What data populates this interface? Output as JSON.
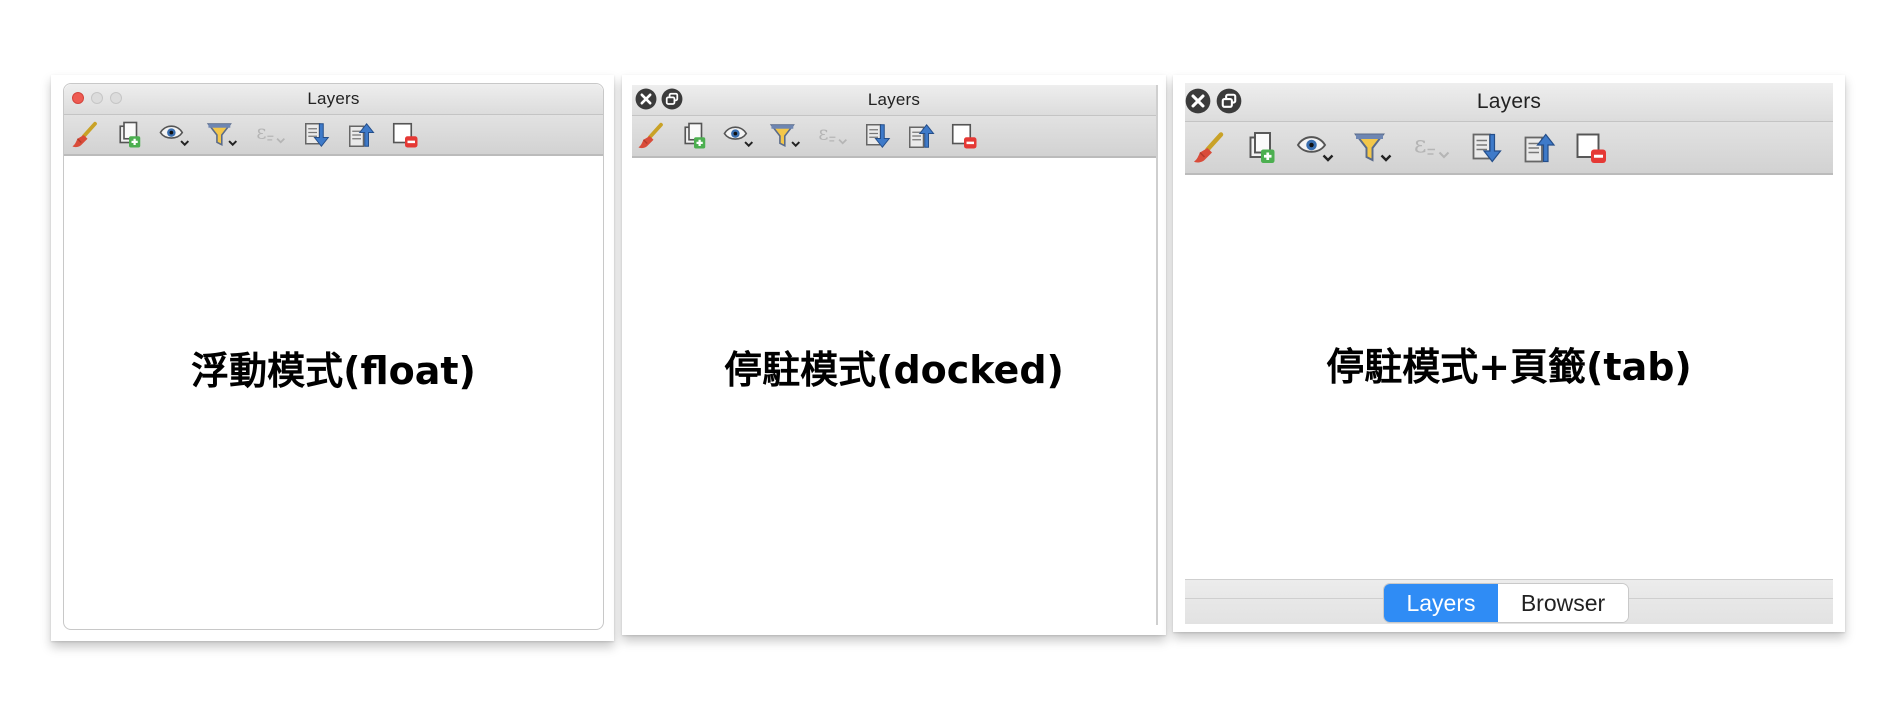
{
  "panels": [
    {
      "mode": "float",
      "title": "Layers",
      "caption": "浮動模式(float)"
    },
    {
      "mode": "docked",
      "title": "Layers",
      "caption": "停駐模式(docked)"
    },
    {
      "mode": "tab",
      "title": "Layers",
      "caption": "停駐模式+頁籤(tab)",
      "tabs": [
        {
          "label": "Layers",
          "active": true
        },
        {
          "label": "Browser",
          "active": false
        }
      ]
    }
  ],
  "toolbar_icons": [
    "style-brush-icon",
    "add-group-icon",
    "visibility-icon",
    "filter-legend-icon",
    "filter-expression-icon",
    "expand-all-icon",
    "collapse-all-icon",
    "remove-layer-icon"
  ],
  "colors": {
    "accent": "#2f8cf5",
    "close_light": "#ee5b52"
  }
}
